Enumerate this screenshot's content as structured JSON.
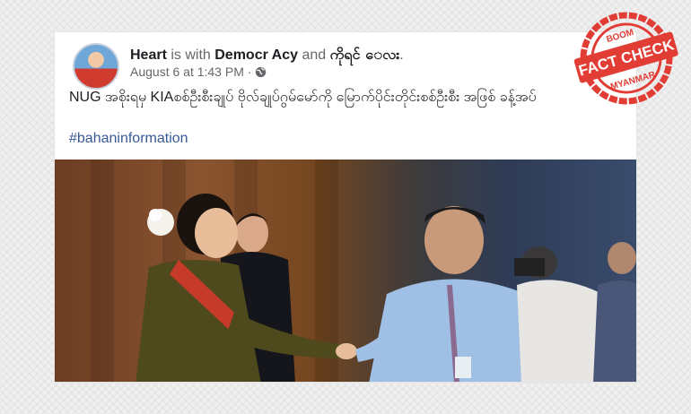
{
  "post": {
    "author": "Heart",
    "is_with": " is with ",
    "tagged_1": "Democr Acy",
    "and": " and ",
    "tagged_2": "ကိုရင် ေလး",
    "period": ".",
    "timestamp": "August 6 at 1:43 PM · ",
    "text": "NUG အစိုးရမှ  KIAစစ်ဦးစီးချုပ် ဗိုလ်ချုပ်ဂွမ်မော်ကို မြောက်ပိုင်းတိုင်းစစ်ဦးစီး အဖြစ် ခန့်အပ်",
    "hashtag": "#bahaninformation"
  },
  "badge": {
    "top": "BOOM",
    "main": "FACT CHECK",
    "bottom": "MYANMAR",
    "color": "#e23d35"
  },
  "icons": {
    "privacy": "globe-icon"
  }
}
